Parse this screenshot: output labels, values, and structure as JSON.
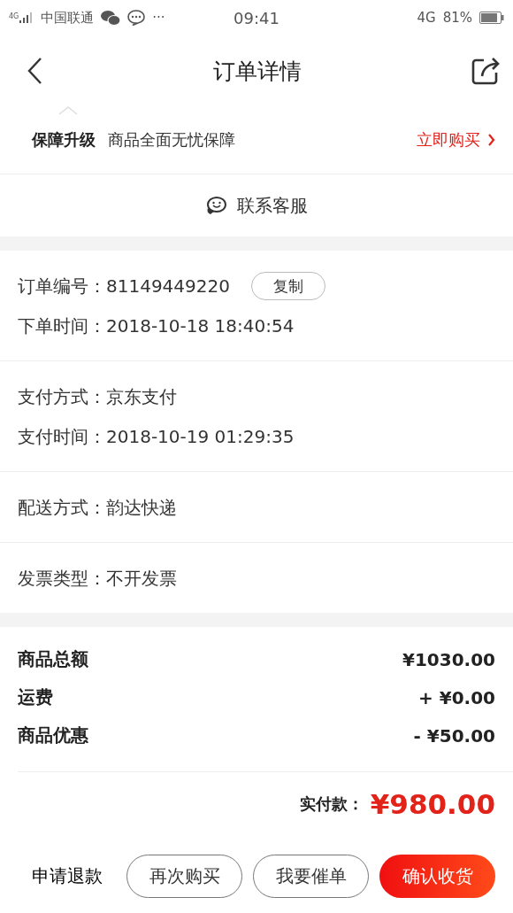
{
  "status_bar": {
    "network_label": "4G",
    "carrier": "中国联通",
    "more": "···",
    "time": "09:41",
    "mobile": "4G",
    "battery": "81%"
  },
  "header": {
    "title": "订单详情"
  },
  "guarantee": {
    "title": "保障升级",
    "text": "商品全面无忧保障",
    "action": "立即购买"
  },
  "contact": {
    "label": "联系客服"
  },
  "info_groups": [
    {
      "rows": [
        {
          "label": "订单编号：",
          "value": "81149449220",
          "action": "复制"
        },
        {
          "label": "下单时间：",
          "value": "2018-10-18 18:40:54"
        }
      ]
    },
    {
      "rows": [
        {
          "label": "支付方式：",
          "value": "京东支付"
        },
        {
          "label": "支付时间：",
          "value": "2018-10-19 01:29:35"
        }
      ]
    },
    {
      "rows": [
        {
          "label": "配送方式：",
          "value": "韵达快递"
        }
      ]
    },
    {
      "rows": [
        {
          "label": "发票类型：",
          "value": "不开发票"
        }
      ]
    }
  ],
  "amounts": [
    {
      "label": "商品总额",
      "value": "¥1030.00"
    },
    {
      "label": "运费",
      "value": "+ ¥0.00"
    },
    {
      "label": "商品优惠",
      "value": "- ¥50.00"
    }
  ],
  "total": {
    "label": "实付款：",
    "value": "¥980.00"
  },
  "buttons": [
    {
      "label": "申请退款",
      "kind": "text"
    },
    {
      "label": "再次购买",
      "kind": "outline"
    },
    {
      "label": "我要催单",
      "kind": "outline"
    },
    {
      "label": "确认收货",
      "kind": "primary"
    }
  ]
}
